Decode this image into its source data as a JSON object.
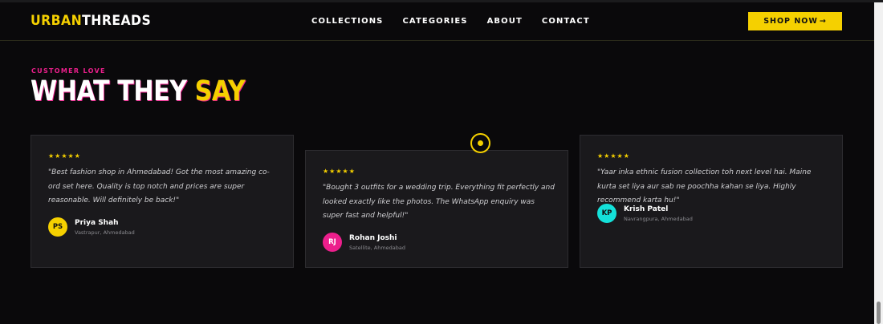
{
  "brand": {
    "part1": "URBAN",
    "part2": "THREADS"
  },
  "nav": {
    "items": [
      "COLLECTIONS",
      "CATEGORIES",
      "ABOUT",
      "CONTACT"
    ]
  },
  "cta": {
    "label": "SHOP NOW",
    "arrow": "→"
  },
  "section": {
    "eyebrow": "CUSTOMER LOVE",
    "title_white": "WHAT THEY",
    "title_yellow": "SAY"
  },
  "testimonials": [
    {
      "stars": "★★★★★",
      "quote": "\"Best fashion shop in Ahmedabad! Got the most amazing co-ord set here. Quality is top notch and prices are super reasonable. Will definitely be back!\"",
      "initials": "PS",
      "name": "Priya Shah",
      "location": "Vastrapur, Ahmedabad",
      "avatar_color": "#f5d000"
    },
    {
      "stars": "★★★★★",
      "quote": "\"Bought 3 outfits for a wedding trip. Everything fit perfectly and looked exactly like the photos. The WhatsApp enquiry was super fast and helpful!\"",
      "initials": "RJ",
      "name": "Rohan Joshi",
      "location": "Satellite, Ahmedabad",
      "avatar_color": "#ec1f8c"
    },
    {
      "stars": "★★★★★",
      "quote": "\"Yaar inka ethnic fusion collection toh next level hai. Maine kurta set liya aur sab ne poochha kahan se liya. Highly recommend karta hu!\"",
      "initials": "KP",
      "name": "Krish Patel",
      "location": "Navrangpura, Ahmedabad",
      "avatar_color": "#14e0d9"
    }
  ],
  "colors": {
    "accent_yellow": "#f5d000",
    "accent_pink": "#ec1f8c",
    "background": "#0a090b"
  }
}
